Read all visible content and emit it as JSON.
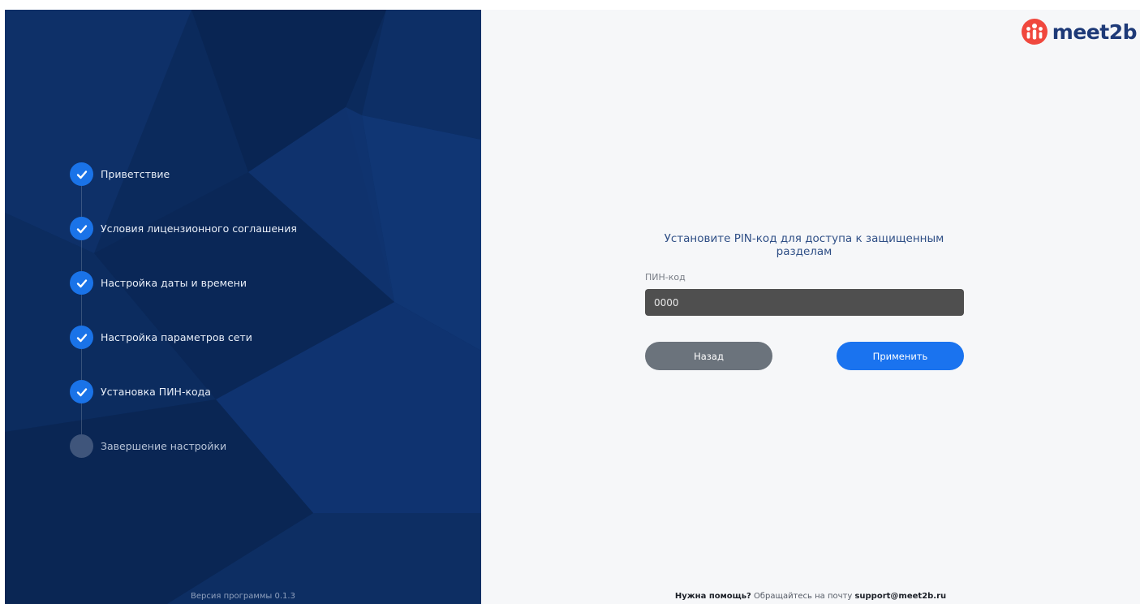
{
  "brand": {
    "logo_text": "meet2b",
    "accent_color": "#f0483e",
    "text_color": "#1e3a78"
  },
  "sidebar": {
    "steps": [
      {
        "label": "Приветствие",
        "status": "done"
      },
      {
        "label": "Условия лицензионного соглашения",
        "status": "done"
      },
      {
        "label": "Настройка даты и времени",
        "status": "done"
      },
      {
        "label": "Настройка параметров сети",
        "status": "done"
      },
      {
        "label": "Установка ПИН-кода",
        "status": "done"
      },
      {
        "label": "Завершение настройки",
        "status": "pending"
      }
    ],
    "version_text": "Версия программы 0.1.3"
  },
  "form": {
    "title": "Установите PIN-код для доступа к защищенным разделам",
    "pin_label": "ПИН-код",
    "pin_value": "0000",
    "back_label": "Назад",
    "apply_label": "Применить"
  },
  "footer": {
    "help_bold": "Нужна помощь?",
    "help_text": " Обращайтесь на почту ",
    "email": "support@meet2b.ru"
  }
}
